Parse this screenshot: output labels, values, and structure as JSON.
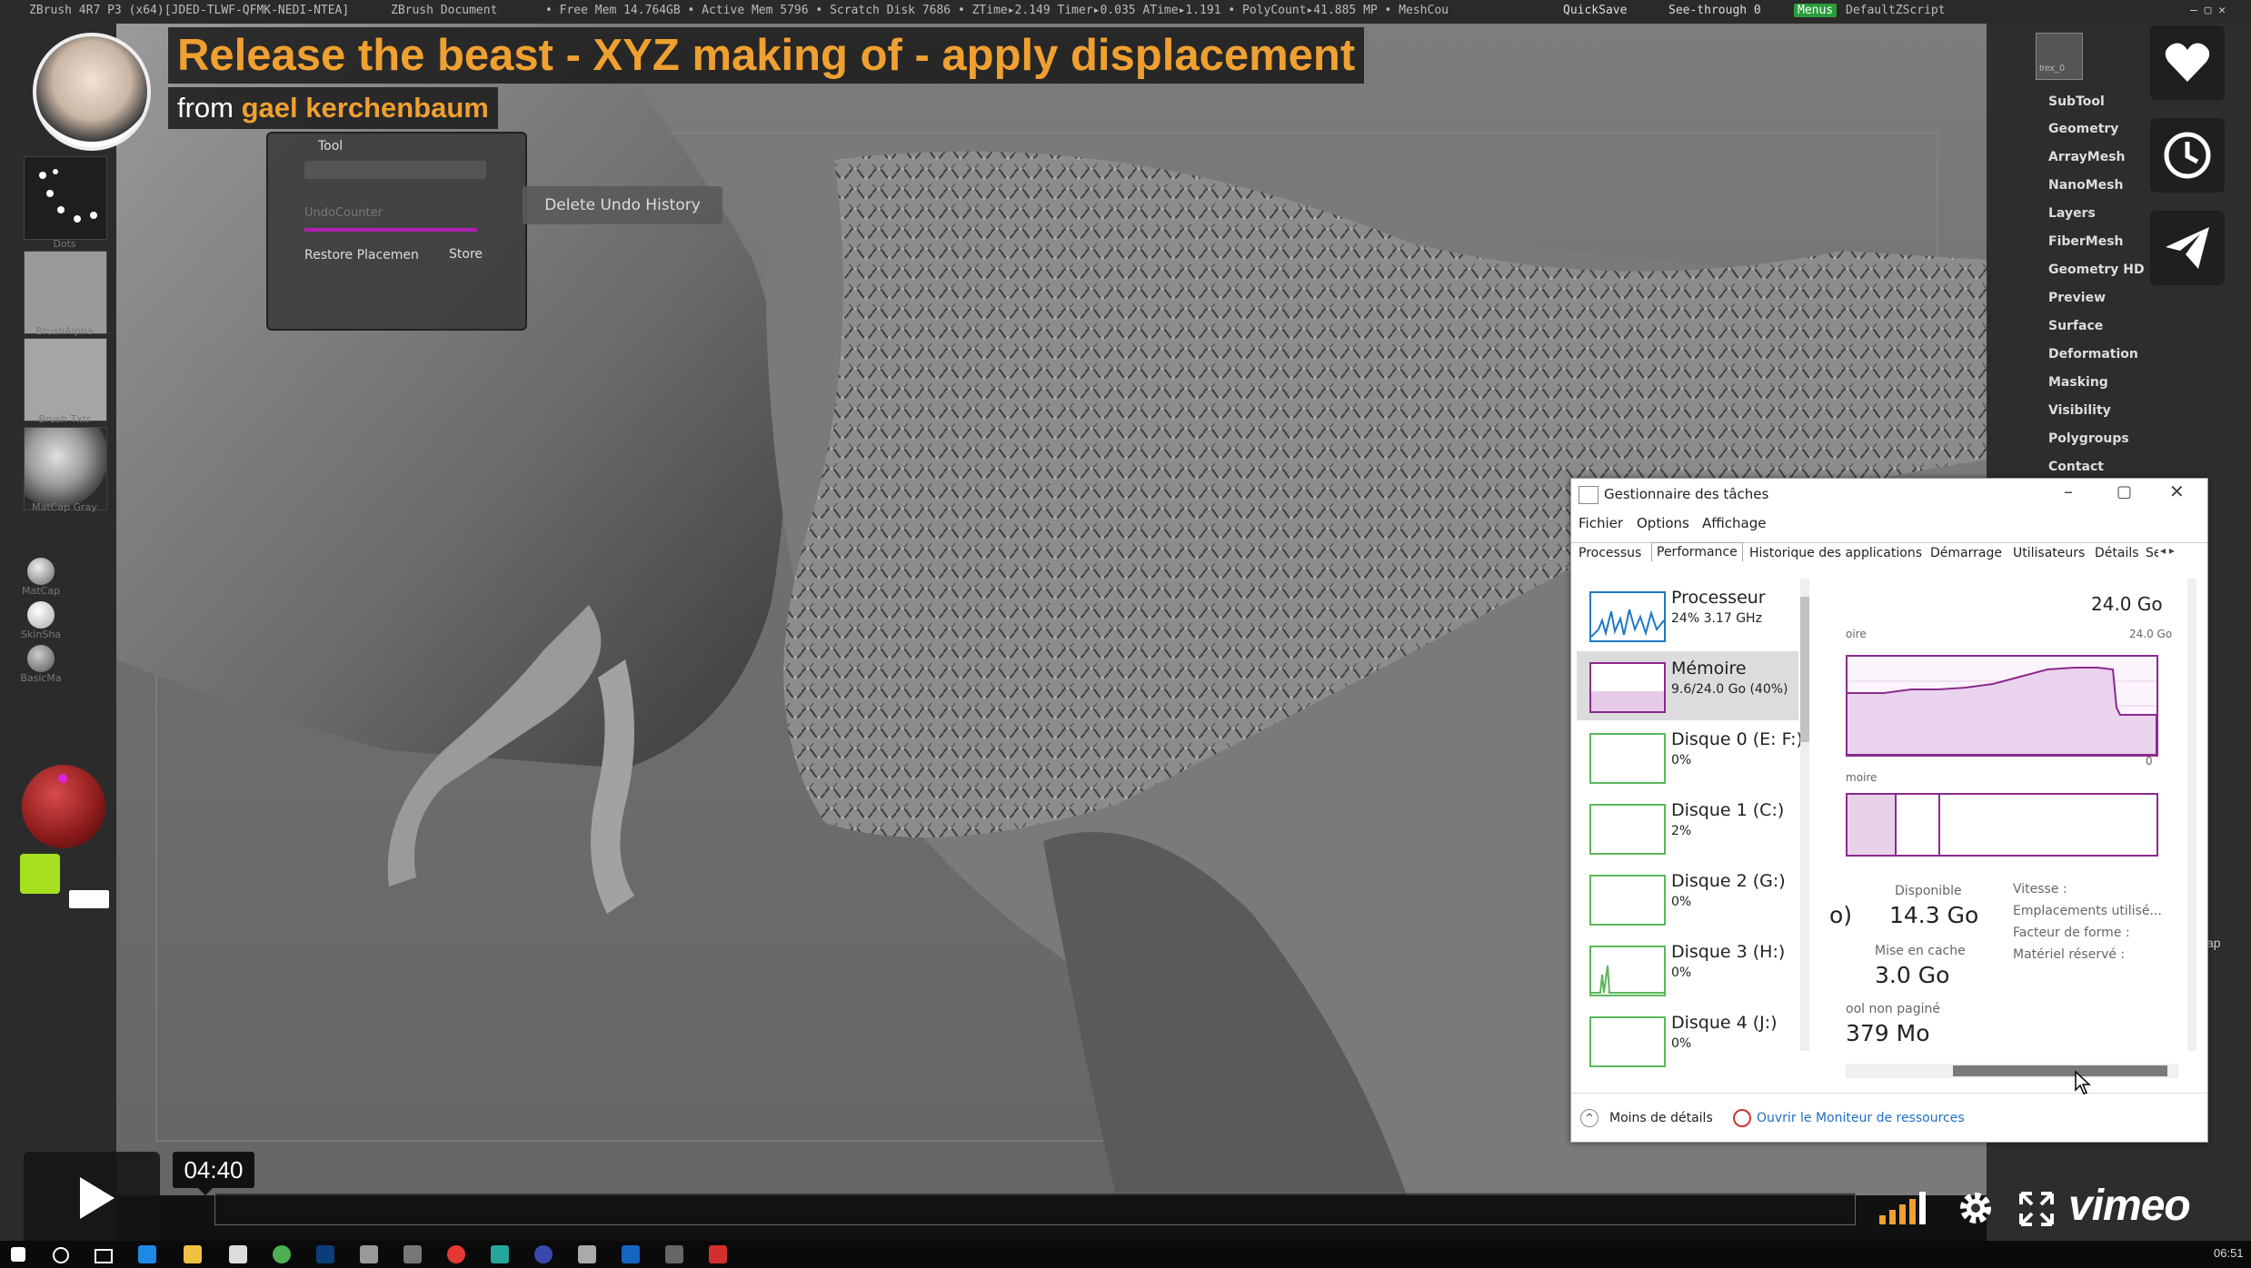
{
  "zbrush_topbar": {
    "app_info": "ZBrush 4R7 P3 (x64)[JDED-TLWF-QFMK-NEDI-NTEA]",
    "document": "ZBrush Document",
    "stats": "• Free Mem 14.764GB • Active Mem 5796 • Scratch Disk 7686 •  ZTime▸2.149  Timer▸0.035  ATime▸1.191 • PolyCount▸41.885 MP • MeshCou",
    "quicksave": "QuickSave",
    "see_through": "See-through  0",
    "menus": "Menus",
    "script": "DefaultZScript"
  },
  "zbrush_left": {
    "labels": [
      "Dots",
      "BrushAlpha",
      "Brush Txtr",
      "MatCap Gray",
      "MatCap",
      "SkinSha",
      "BasicMa"
    ]
  },
  "zbrush_right": {
    "tool_thumb_label": "trex_0",
    "menu": [
      "SubTool",
      "Geometry",
      "ArrayMesh",
      "NanoMesh",
      "Layers",
      "FiberMesh",
      "Geometry HD",
      "Preview",
      "Surface",
      "Deformation",
      "Masking",
      "Visibility",
      "Polygroups",
      "Contact"
    ],
    "partial_label": "ap"
  },
  "tool_popup": {
    "title": "Tool",
    "undo_counter": "UndoCounter",
    "delete": "Delete Undo History",
    "restore": "Restore Placemen",
    "store": "Store"
  },
  "video": {
    "title": "Release the beast - XYZ making of - apply displacement",
    "from": "from",
    "author": "gael kerchenbaum",
    "time": "04:40",
    "brand": "vimeo",
    "progress": 0.0
  },
  "task_manager": {
    "window_title": "Gestionnaire des tâches",
    "menu": [
      "Fichier",
      "Options",
      "Affichage"
    ],
    "tabs": [
      "Processus",
      "Performance",
      "Historique des applications",
      "Démarrage",
      "Utilisateurs",
      "Détails",
      "Se"
    ],
    "active_tab": "Performance",
    "resources": [
      {
        "name": "Processeur",
        "detail": "24% 3.17 GHz"
      },
      {
        "name": "Mémoire",
        "detail": "9.6/24.0 Go (40%)"
      },
      {
        "name": "Disque 0 (E: F:)",
        "detail": "0%"
      },
      {
        "name": "Disque 1 (C:)",
        "detail": "2%"
      },
      {
        "name": "Disque 2 (G:)",
        "detail": "0%"
      },
      {
        "name": "Disque 3 (H:)",
        "detail": "0%"
      },
      {
        "name": "Disque 4 (J:)",
        "detail": "0%"
      }
    ],
    "total": "24.0 Go",
    "graph1_label": "oire",
    "graph1_max": "24.0 Go",
    "graph1_min": "0",
    "graph2_label": "moire",
    "disponible_label": "Disponible",
    "disponible_value": "14.3 Go",
    "partial_left": "o)",
    "cache_label": "Mise en cache",
    "cache_value": "3.0 Go",
    "pool_label": "ool non paginé",
    "pool_value": "379 Mo",
    "right_labels": [
      "Vitesse :",
      "Emplacements utilisé...",
      "Facteur de forme :",
      "Matériel réservé :"
    ],
    "less_details": "Moins de détails",
    "open_monitor": "Ouvrir le Moniteur de ressources"
  },
  "taskbar": {
    "clock": "06:51"
  },
  "colors": {
    "accent_orange": "#f0a030",
    "vimeo_bg": "#1f1f1f",
    "graph_purple": "#8b2a8e",
    "disk_green": "#5cb85c"
  }
}
